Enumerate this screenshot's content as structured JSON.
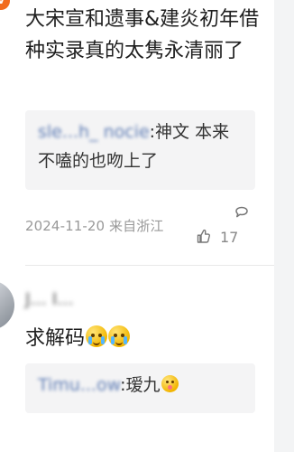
{
  "corner_badge": "V",
  "comment_1": {
    "text": "大宋宣和遗事&建炎初年借种实录真的太隽永清丽了",
    "quote_user": "sle...h_ nocie",
    "quote_text": ":神文 本来不嗑的也吻上了",
    "meta": "2024-11-20 来自浙江",
    "like_count": "17"
  },
  "comment_2": {
    "username": "J... I...",
    "text": "求解码",
    "quote_user": "Timu...ow",
    "quote_text": ":瑷九"
  },
  "icons": {
    "reply": "reply-icon",
    "like": "thumb-up-icon"
  },
  "colors": {
    "accent": "#5f7db5",
    "badge": "#f26b1d",
    "meta": "#999999"
  }
}
